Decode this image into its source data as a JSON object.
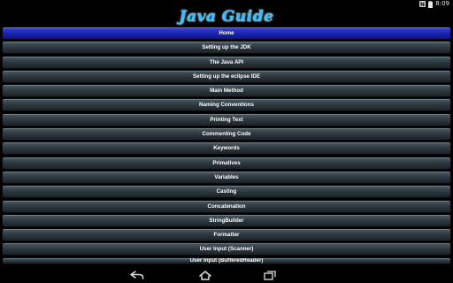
{
  "status": {
    "time": "8:09"
  },
  "header": {
    "title": "Java Guide"
  },
  "menu": {
    "items": [
      {
        "label": "Home"
      },
      {
        "label": "Setting up the JDK"
      },
      {
        "label": "The Java API"
      },
      {
        "label": "Setting up the eclipse IDE"
      },
      {
        "label": "Main Method"
      },
      {
        "label": "Naming Conventions"
      },
      {
        "label": "Printing Text"
      },
      {
        "label": "Commenting Code"
      },
      {
        "label": "Keywords"
      },
      {
        "label": "Primatives"
      },
      {
        "label": "Variables"
      },
      {
        "label": "Casting"
      },
      {
        "label": "Concatenation"
      },
      {
        "label": "StringBuilder"
      },
      {
        "label": "Formatter"
      },
      {
        "label": "User Input (Scanner)"
      },
      {
        "label": "User Input (BufferedReader)"
      }
    ]
  },
  "colors": {
    "title": "#3bbcff",
    "active_item": "#1c24b0",
    "item": "#303a42"
  },
  "icons": {
    "status": [
      "n-icon",
      "battery-icon"
    ],
    "nav": [
      "back-icon",
      "home-icon",
      "recent-apps-icon"
    ]
  }
}
